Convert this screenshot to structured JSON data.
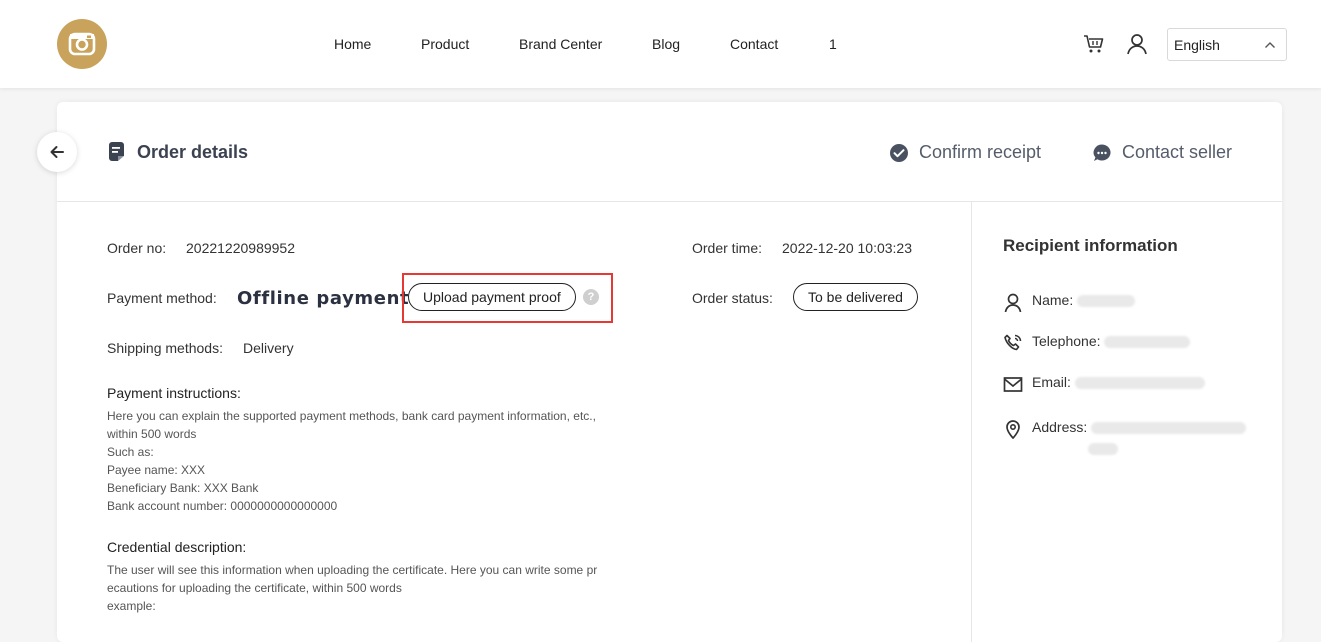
{
  "nav": {
    "items": [
      "Home",
      "Product",
      "Brand Center",
      "Blog",
      "Contact",
      "1"
    ],
    "language": "English"
  },
  "order": {
    "title": "Order details",
    "confirm_label": "Confirm receipt",
    "contact_label": "Contact seller",
    "order_no_label": "Order no:",
    "order_no": "20221220989952",
    "order_time_label": "Order time:",
    "order_time": "2022-12-20 10:03:23",
    "payment_method_label": "Payment method:",
    "payment_method": "Offline payment",
    "upload_label": "Upload payment proof",
    "help_icon": "?",
    "order_status_label": "Order status:",
    "order_status": "To be delivered",
    "shipping_label": "Shipping methods:",
    "shipping": "Delivery",
    "payment_instructions_title": "Payment instructions:",
    "payment_instructions": [
      "Here you can explain the supported payment methods, bank card payment information, etc.,",
      "within 500 words",
      "Such as:",
      "Payee name: XXX",
      "Beneficiary Bank: XXX Bank",
      "Bank account number: 0000000000000000"
    ],
    "credential_title": "Credential description:",
    "credential_lines": [
      "The user will see this information when uploading the certificate. Here you can write some pr",
      "ecautions for uploading the certificate, within 500 words",
      "example:"
    ]
  },
  "recipient": {
    "title": "Recipient information",
    "name_label": "Name:",
    "telephone_label": "Telephone:",
    "email_label": "Email:",
    "address_label": "Address:"
  },
  "colors": {
    "brand": "#c9a25b",
    "highlight": "#e53935"
  }
}
